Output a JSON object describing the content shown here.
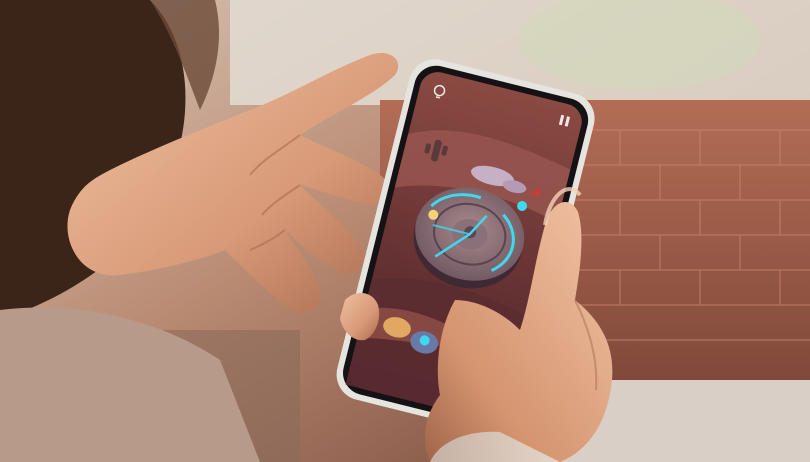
{
  "scene": {
    "description_colors": {
      "wall": "#9a5a44",
      "brick_light": "#b9735c",
      "skin": "#e3a582",
      "skin_shadow": "#b8775a",
      "phone_frame": "#dcdcd6",
      "screen_bg": "#6e3a36",
      "ring_glow": "#3fd8ee",
      "hair": "#3b2418"
    },
    "game_ui": {
      "hint_icon": "lightbulb-icon",
      "pause_icon": "pause-icon"
    }
  }
}
